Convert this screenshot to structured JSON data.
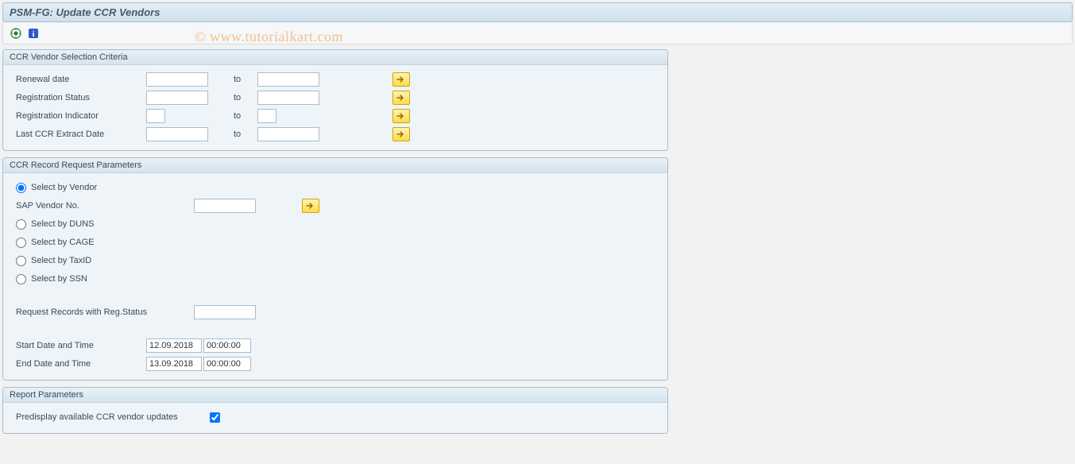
{
  "title": "PSM-FG: Update CCR Vendors",
  "watermark": "© www.tutorialkart.com",
  "toolbar": {
    "execute_icon": "execute",
    "info_icon": "info"
  },
  "group1": {
    "title": "CCR Vendor Selection Criteria",
    "rows": [
      {
        "label": "Renewal date",
        "from": "",
        "to_label": "to",
        "to": "",
        "more": true,
        "narrow": false
      },
      {
        "label": "Registration Status",
        "from": "",
        "to_label": "to",
        "to": "",
        "more": true,
        "narrow": false
      },
      {
        "label": "Registration Indicator",
        "from": "",
        "to_label": "to",
        "to": "",
        "more": true,
        "narrow": true
      },
      {
        "label": "Last CCR Extract Date",
        "from": "",
        "to_label": "to",
        "to": "",
        "more": true,
        "narrow": false
      }
    ]
  },
  "group2": {
    "title": "CCR Record Request Parameters",
    "radios": [
      {
        "label": "Select by Vendor",
        "checked": true,
        "sub": {
          "label": "SAP Vendor No.",
          "value": "",
          "more": true
        }
      },
      {
        "label": "Select by DUNS",
        "checked": false
      },
      {
        "label": "Select by CAGE",
        "checked": false
      },
      {
        "label": "Select by TaxID",
        "checked": false
      },
      {
        "label": "Select by SSN",
        "checked": false
      }
    ],
    "reg_status_label": "Request Records with Reg.Status",
    "reg_status_value": "",
    "start_label": "Start Date and Time",
    "start_date": "12.09.2018",
    "start_time": "00:00:00",
    "end_label": "End Date and Time",
    "end_date": "13.09.2018",
    "end_time": "00:00:00"
  },
  "group3": {
    "title": "Report Parameters",
    "predisplay_label": "Predisplay available CCR vendor updates",
    "predisplay_checked": true
  }
}
